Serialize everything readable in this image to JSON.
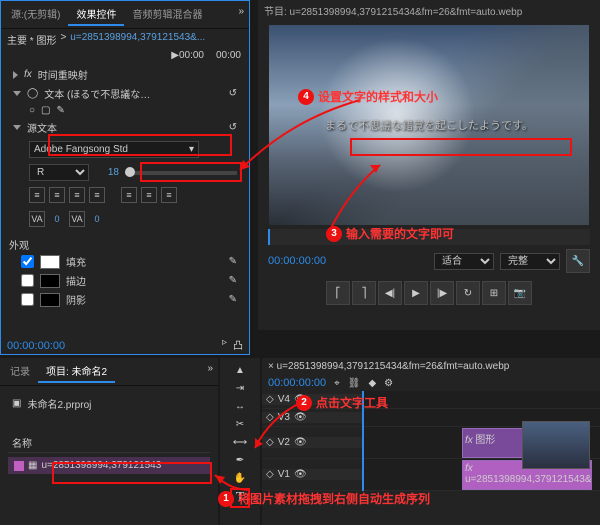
{
  "fx": {
    "tab_source": "源:(无剪辑)",
    "tab_effect": "效果控件",
    "tab_audio": "音频剪辑混合器",
    "breadcrumb_main": "主要 * 图形",
    "breadcrumb_clip": "u=2851398994,379121543&...",
    "time_ruler_start": "▶00:00",
    "time_ruler_end": "00:00",
    "section_time_remap": "时间重映射",
    "section_text": "文本 (ほるで不思議な…",
    "section_source_text": "源文本",
    "font_family": "Adobe Fangsong Std",
    "font_style": "R",
    "font_size": "18",
    "section_appearance": "外观",
    "fill_label": "填充",
    "stroke_label": "描边",
    "shadow_label": "阴影",
    "timecode": "00:00:00:00"
  },
  "prog": {
    "title": "节目: u=2851398994,3791215434&fm=26&fmt=auto.webp",
    "subtitle_text": "まるで不思議な錯覚を起こしたようです。",
    "timecode": "00:00:00:00",
    "fit_label": "适合",
    "full_label": "完整"
  },
  "proj": {
    "tab_record": "记录",
    "tab_project": "项目: 未命名2",
    "project_file": "未命名2.prproj",
    "col_name": "名称",
    "clip_name": "u=2851398994,379121543"
  },
  "tl": {
    "title": "u=2851398994,3791215434&fm=26&fmt=auto.webp",
    "timecode": "00:00:00:00",
    "tracks_v": [
      "V4",
      "V3",
      "V2",
      "V1"
    ],
    "clip_graphic": "图形",
    "clip_image": "u=2851398994,379121543&..."
  },
  "anno": {
    "n1": "将图片素材拖拽到右侧自动生成序列",
    "n2": "点击文字工具",
    "n3": "输入需要的文字即可",
    "n4": "设置文字的样式和大小"
  }
}
